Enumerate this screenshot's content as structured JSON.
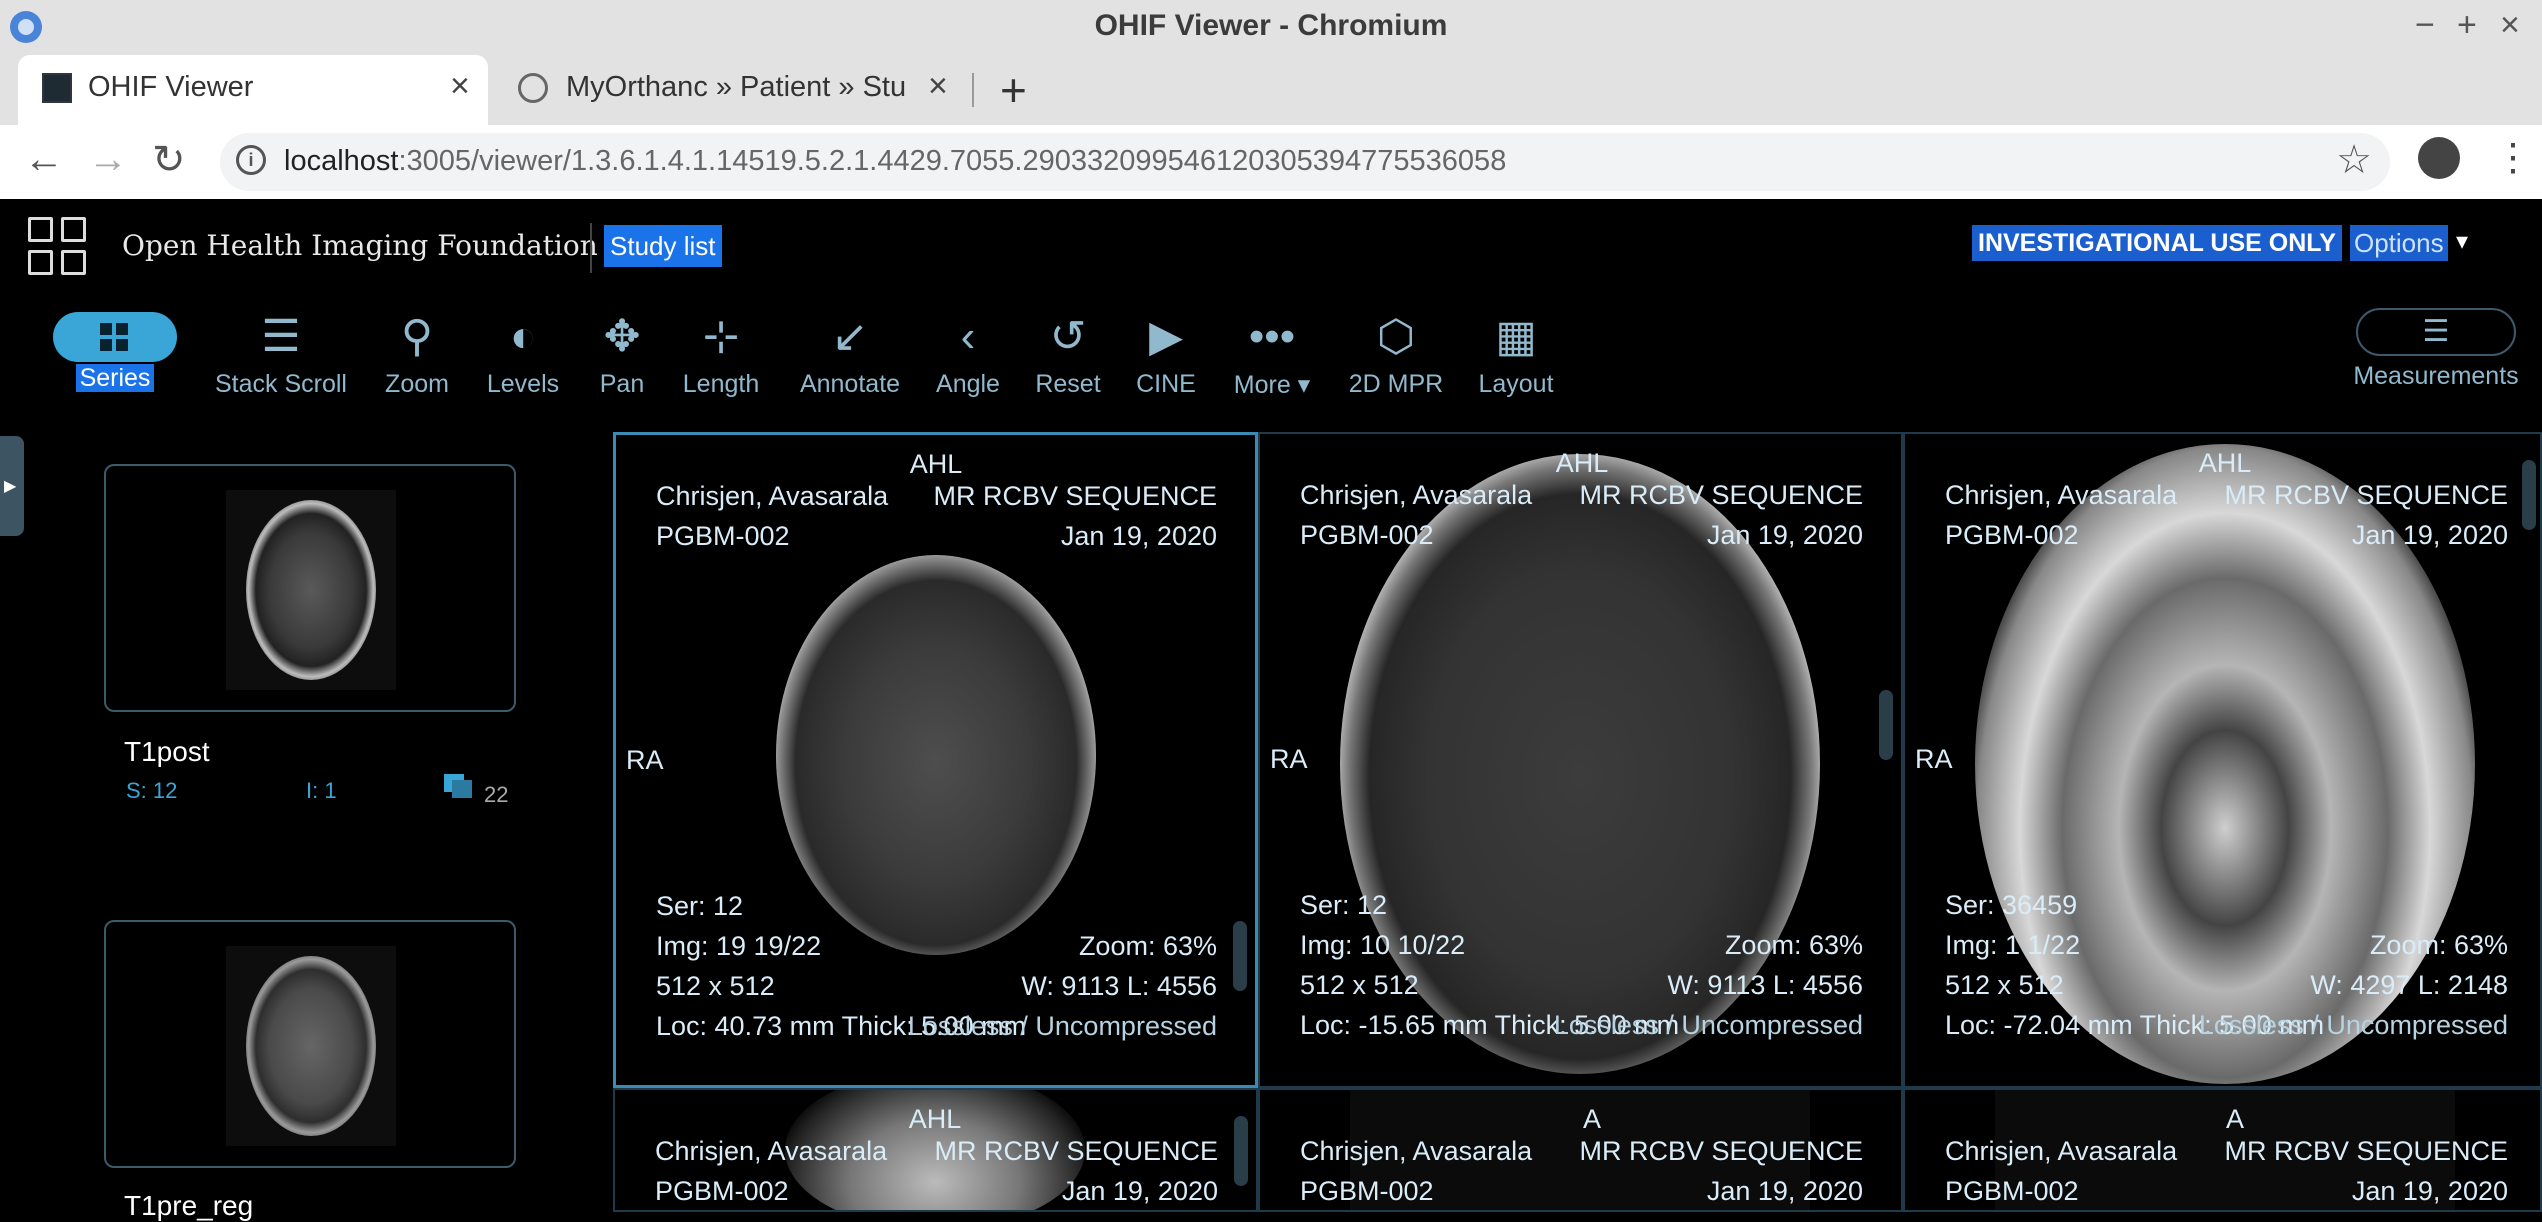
{
  "window": {
    "title": "OHIF Viewer - Chromium",
    "controls": [
      "−",
      "+",
      "×"
    ]
  },
  "tabs": [
    {
      "label": "OHIF Viewer",
      "close": "×"
    },
    {
      "label": "MyOrthanc » Patient » Stu",
      "close": "×"
    }
  ],
  "newtab": "+",
  "address": {
    "host": "localhost",
    "path": ":3005/viewer/1.3.6.1.4.1.14519.5.2.1.4429.7055.290332099546120305394775536058"
  },
  "nav": {
    "back": "←",
    "forward": "→",
    "reload": "↻",
    "info": "i",
    "star": "☆",
    "menu": "⋮"
  },
  "header": {
    "brand": "Open Health Imaging Foundation",
    "study_list": "Study list",
    "investigational": "INVESTIGATIONAL USE ONLY",
    "options": "Options",
    "options_caret": "▾"
  },
  "tools": [
    {
      "label": "Series",
      "icon": "series-grid-icon"
    },
    {
      "label": "Stack Scroll",
      "glyph": "☰"
    },
    {
      "label": "Zoom",
      "glyph": "⚲"
    },
    {
      "label": "Levels",
      "glyph": "◐"
    },
    {
      "label": "Pan",
      "glyph": "✥"
    },
    {
      "label": "Length",
      "glyph": "⊹"
    },
    {
      "label": "Annotate",
      "glyph": "↙"
    },
    {
      "label": "Angle",
      "glyph": "‹"
    },
    {
      "label": "Reset",
      "glyph": "↺"
    },
    {
      "label": "CINE",
      "glyph": "▶"
    },
    {
      "label": "More ▾",
      "glyph": "•••"
    },
    {
      "label": "2D MPR",
      "glyph": "⬡"
    },
    {
      "label": "Layout",
      "glyph": "▦"
    }
  ],
  "measurements": {
    "label": "Measurements",
    "glyph": "☰"
  },
  "series": [
    {
      "title": "T1post",
      "s": "S: 12",
      "i": "I: 1",
      "count": "22"
    },
    {
      "title": "T1pre_reg"
    }
  ],
  "viewports": [
    {
      "top": "AHL",
      "left": "RA",
      "name": "Chrisjen, Avasarala",
      "id": "PGBM-002",
      "desc": "MR RCBV SEQUENCE",
      "date": "Jan 19, 2020",
      "ser": "Ser: 12",
      "img": "Img: 19 19/22",
      "size": "512 x 512",
      "loc": "Loc: 40.73 mm Thick: 5.00 mm",
      "zoom": "Zoom: 63%",
      "wl": "W: 9113 L: 4556",
      "comp": "Lossless / Uncompressed"
    },
    {
      "top": "AHL",
      "left": "RA",
      "name": "Chrisjen, Avasarala",
      "id": "PGBM-002",
      "desc": "MR RCBV SEQUENCE",
      "date": "Jan 19, 2020",
      "ser": "Ser: 12",
      "img": "Img: 10 10/22",
      "size": "512 x 512",
      "loc": "Loc: -15.65 mm Thick: 5.00 mm",
      "zoom": "Zoom: 63%",
      "wl": "W: 9113 L: 4556",
      "comp": "Lossless / Uncompressed"
    },
    {
      "top": "AHL",
      "left": "RA",
      "name": "Chrisjen, Avasarala",
      "id": "PGBM-002",
      "desc": "MR RCBV SEQUENCE",
      "date": "Jan 19, 2020",
      "ser": "Ser: 36459",
      "img": "Img: 1 1/22",
      "size": "512 x 512",
      "loc": "Loc: -72.04 mm Thick: 5.00 mm",
      "zoom": "Zoom: 63%",
      "wl": "W: 4297 L: 2148",
      "comp": "Lossless / Uncompressed"
    },
    {
      "top": "AHL",
      "name": "Chrisjen, Avasarala",
      "id": "PGBM-002",
      "desc": "MR RCBV SEQUENCE",
      "date": "Jan 19, 2020"
    },
    {
      "top": "A",
      "name": "Chrisjen, Avasarala",
      "id": "PGBM-002",
      "desc": "MR RCBV SEQUENCE",
      "date": "Jan 19, 2020"
    },
    {
      "top": "A",
      "name": "Chrisjen, Avasarala",
      "id": "PGBM-002",
      "desc": "MR RCBV SEQUENCE",
      "date": "Jan 19, 2020"
    }
  ],
  "colors": {
    "accent": "#3aa6d8",
    "highlight": "#1a73e8",
    "tool_text": "#91b9cd",
    "viewport_border": "#3a8bb3"
  }
}
